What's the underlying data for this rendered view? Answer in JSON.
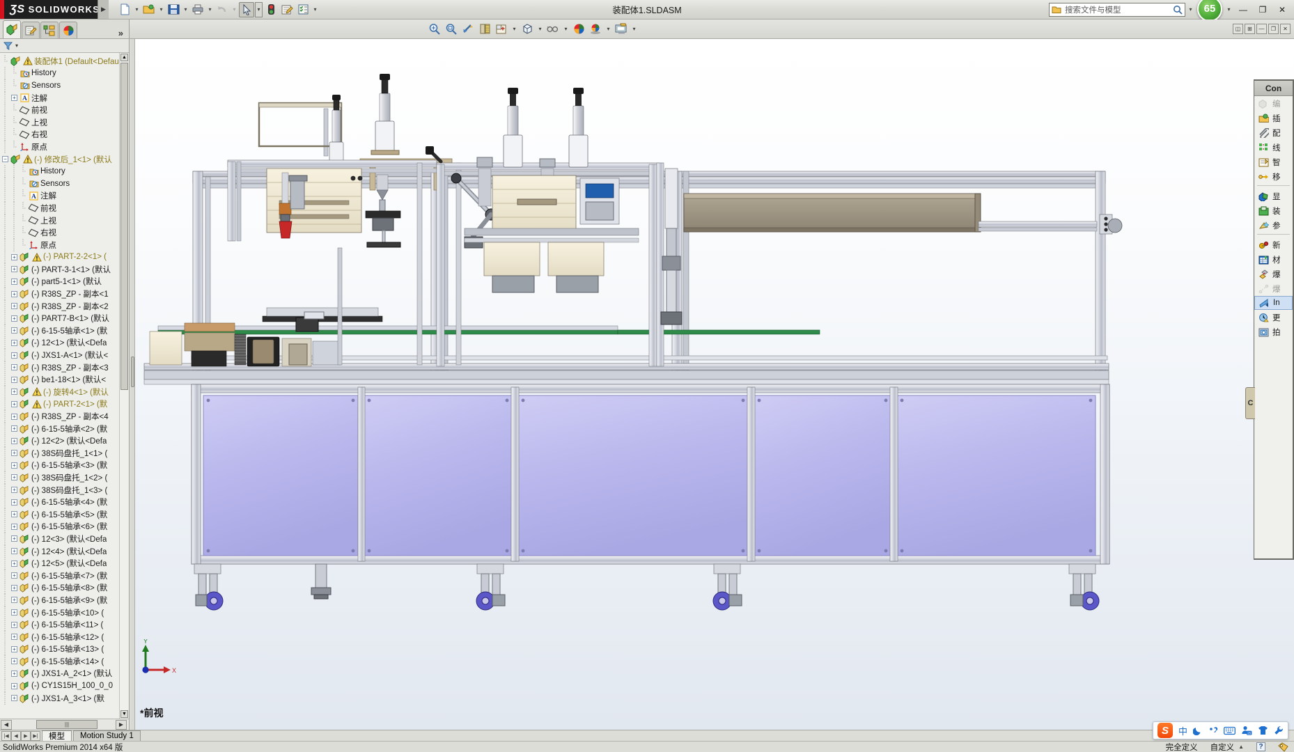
{
  "window": {
    "app_name": "SOLIDWORKS",
    "document_title": "装配体1.SLDASM",
    "help_badge": "65",
    "minimize": "—",
    "restore": "❐",
    "close": "✕"
  },
  "search": {
    "placeholder": "搜索文件与模型",
    "icon": "search-icon"
  },
  "standard_toolbar": [
    {
      "name": "new-document",
      "icon": "page-icon",
      "dropdown": true
    },
    {
      "name": "open-document",
      "icon": "folder-open-icon",
      "dropdown": true
    },
    {
      "name": "save-document",
      "icon": "floppy-icon",
      "dropdown": true
    },
    {
      "name": "print-document",
      "icon": "printer-icon",
      "dropdown": true
    },
    {
      "name": "undo",
      "icon": "undo-arrow-icon",
      "dropdown": true,
      "disabled": true
    },
    {
      "name": "select",
      "icon": "cursor-arrow-icon",
      "dropdown": true,
      "selected": true
    },
    {
      "name": "rebuild",
      "icon": "traffic-light-icon",
      "dropdown": false
    },
    {
      "name": "file-properties",
      "icon": "document-pencil-icon",
      "dropdown": false
    },
    {
      "name": "options",
      "icon": "checklist-gear-icon",
      "dropdown": true
    }
  ],
  "view_toolbar": [
    {
      "name": "zoom-to-fit",
      "icon": "magnifier-fit-icon"
    },
    {
      "name": "zoom-to-area",
      "icon": "magnifier-area-icon"
    },
    {
      "name": "previous-view",
      "icon": "previous-view-icon"
    },
    {
      "name": "section-view",
      "icon": "section-view-icon"
    },
    {
      "name": "view-orientation",
      "icon": "view-orientation-icon",
      "dropdown": true
    },
    {
      "name": "display-style",
      "icon": "cube-icon",
      "dropdown": true
    },
    {
      "name": "hide-show-items",
      "icon": "glasses-icon",
      "dropdown": true
    },
    {
      "name": "apply-scene",
      "icon": "color-sphere-icon"
    },
    {
      "name": "view-settings",
      "icon": "sphere-shadow-icon",
      "dropdown": true
    },
    {
      "name": "display-manager-view",
      "icon": "monitor-icon",
      "dropdown": true
    }
  ],
  "left_panel": {
    "tabs": [
      {
        "name": "feature-manager-tab",
        "icon": "feature-tree-icon",
        "active": true
      },
      {
        "name": "property-manager-tab",
        "icon": "property-pencil-icon",
        "active": false
      },
      {
        "name": "configuration-manager-tab",
        "icon": "configuration-icon",
        "active": false
      },
      {
        "name": "display-manager-tab",
        "icon": "color-wheel-icon",
        "active": false
      }
    ],
    "more_label": "»",
    "filter_label": "",
    "filter_icon": "funnel-icon",
    "scroll_thumb_label": "|||"
  },
  "tree": [
    {
      "label": "装配体1  (Default<Defaul",
      "icon": "assembly-icon",
      "indent": 0,
      "expander": "",
      "warn": true,
      "highlight": true
    },
    {
      "label": "History",
      "icon": "history-icon",
      "indent": 1,
      "expander": ""
    },
    {
      "label": "Sensors",
      "icon": "sensors-icon",
      "indent": 1,
      "expander": ""
    },
    {
      "label": "注解",
      "icon": "annotations-icon",
      "indent": 1,
      "expander": "+"
    },
    {
      "label": "前视",
      "icon": "plane-icon",
      "indent": 1,
      "expander": ""
    },
    {
      "label": "上视",
      "icon": "plane-icon",
      "indent": 1,
      "expander": ""
    },
    {
      "label": "右视",
      "icon": "plane-icon",
      "indent": 1,
      "expander": ""
    },
    {
      "label": "原点",
      "icon": "origin-icon",
      "indent": 1,
      "expander": ""
    },
    {
      "label": "(-) 修改后_1<1> (默认",
      "icon": "assembly-icon",
      "indent": 0,
      "expander": "−",
      "warn": true
    },
    {
      "label": "History",
      "icon": "history-icon",
      "indent": 2,
      "expander": ""
    },
    {
      "label": "Sensors",
      "icon": "sensors-icon",
      "indent": 2,
      "expander": ""
    },
    {
      "label": "注解",
      "icon": "annotations-icon",
      "indent": 2,
      "expander": ""
    },
    {
      "label": "前视",
      "icon": "plane-icon",
      "indent": 2,
      "expander": ""
    },
    {
      "label": "上视",
      "icon": "plane-icon",
      "indent": 2,
      "expander": ""
    },
    {
      "label": "右视",
      "icon": "plane-icon",
      "indent": 2,
      "expander": ""
    },
    {
      "label": "原点",
      "icon": "origin-icon",
      "indent": 2,
      "expander": ""
    },
    {
      "label": "(-) PART-2-2<1>  (",
      "icon": "part-green-icon",
      "indent": 1,
      "expander": "+",
      "warn": true
    },
    {
      "label": "(-) PART-3-1<1>  (默认",
      "icon": "part-green-icon",
      "indent": 1,
      "expander": "+"
    },
    {
      "label": "(-) part5-1<1>  (默认",
      "icon": "part-green-icon",
      "indent": 1,
      "expander": "+"
    },
    {
      "label": "(-) R38S_ZP - 副本<1",
      "icon": "part-yellow-icon",
      "indent": 1,
      "expander": "+"
    },
    {
      "label": "(-) R38S_ZP - 副本<2",
      "icon": "part-yellow-icon",
      "indent": 1,
      "expander": "+"
    },
    {
      "label": "(-) PART7-B<1>  (默认",
      "icon": "part-green-icon",
      "indent": 1,
      "expander": "+"
    },
    {
      "label": "(-) 6-15-5轴承<1>  (默",
      "icon": "part-yellow-icon",
      "indent": 1,
      "expander": "+"
    },
    {
      "label": "(-) 12<1>  (默认<Defa",
      "icon": "part-green-icon",
      "indent": 1,
      "expander": "+"
    },
    {
      "label": "(-) JXS1-A<1>  (默认<",
      "icon": "part-green-icon",
      "indent": 1,
      "expander": "+"
    },
    {
      "label": "(-) R38S_ZP - 副本<3",
      "icon": "part-yellow-icon",
      "indent": 1,
      "expander": "+"
    },
    {
      "label": "(-) be1-18<1>  (默认<",
      "icon": "part-yellow-icon",
      "indent": 1,
      "expander": "+"
    },
    {
      "label": "(-) 旋转4<1>  (默认",
      "icon": "part-green-icon",
      "indent": 1,
      "expander": "+",
      "warn": true
    },
    {
      "label": "(-) PART-2<1>  (默",
      "icon": "part-green-icon",
      "indent": 1,
      "expander": "+",
      "warn": true
    },
    {
      "label": "(-) R38S_ZP - 副本<4",
      "icon": "part-yellow-icon",
      "indent": 1,
      "expander": "+"
    },
    {
      "label": "(-) 6-15-5轴承<2>  (默",
      "icon": "part-yellow-icon",
      "indent": 1,
      "expander": "+"
    },
    {
      "label": "(-) 12<2>  (默认<Defa",
      "icon": "part-green-icon",
      "indent": 1,
      "expander": "+"
    },
    {
      "label": "(-) 38S码盘托_1<1>  (",
      "icon": "part-yellow-icon",
      "indent": 1,
      "expander": "+"
    },
    {
      "label": "(-) 6-15-5轴承<3>  (默",
      "icon": "part-yellow-icon",
      "indent": 1,
      "expander": "+"
    },
    {
      "label": "(-) 38S码盘托_1<2>  (",
      "icon": "part-yellow-icon",
      "indent": 1,
      "expander": "+"
    },
    {
      "label": "(-) 38S码盘托_1<3>  (",
      "icon": "part-yellow-icon",
      "indent": 1,
      "expander": "+"
    },
    {
      "label": "(-) 6-15-5轴承<4>  (默",
      "icon": "part-yellow-icon",
      "indent": 1,
      "expander": "+"
    },
    {
      "label": "(-) 6-15-5轴承<5>  (默",
      "icon": "part-yellow-icon",
      "indent": 1,
      "expander": "+"
    },
    {
      "label": "(-) 6-15-5轴承<6>  (默",
      "icon": "part-yellow-icon",
      "indent": 1,
      "expander": "+"
    },
    {
      "label": "(-) 12<3>  (默认<Defa",
      "icon": "part-green-icon",
      "indent": 1,
      "expander": "+"
    },
    {
      "label": "(-) 12<4>  (默认<Defa",
      "icon": "part-green-icon",
      "indent": 1,
      "expander": "+"
    },
    {
      "label": "(-) 12<5>  (默认<Defa",
      "icon": "part-green-icon",
      "indent": 1,
      "expander": "+"
    },
    {
      "label": "(-) 6-15-5轴承<7>  (默",
      "icon": "part-yellow-icon",
      "indent": 1,
      "expander": "+"
    },
    {
      "label": "(-) 6-15-5轴承<8>  (默",
      "icon": "part-yellow-icon",
      "indent": 1,
      "expander": "+"
    },
    {
      "label": "(-) 6-15-5轴承<9>  (默",
      "icon": "part-yellow-icon",
      "indent": 1,
      "expander": "+"
    },
    {
      "label": "(-) 6-15-5轴承<10>  (",
      "icon": "part-yellow-icon",
      "indent": 1,
      "expander": "+"
    },
    {
      "label": "(-) 6-15-5轴承<11>  (",
      "icon": "part-yellow-icon",
      "indent": 1,
      "expander": "+"
    },
    {
      "label": "(-) 6-15-5轴承<12>  (",
      "icon": "part-yellow-icon",
      "indent": 1,
      "expander": "+"
    },
    {
      "label": "(-) 6-15-5轴承<13>  (",
      "icon": "part-yellow-icon",
      "indent": 1,
      "expander": "+"
    },
    {
      "label": "(-) 6-15-5轴承<14>  (",
      "icon": "part-yellow-icon",
      "indent": 1,
      "expander": "+"
    },
    {
      "label": "(-) JXS1-A_2<1>  (默认",
      "icon": "part-green-icon",
      "indent": 1,
      "expander": "+"
    },
    {
      "label": "(-) CY1S15H_100_0_0",
      "icon": "part-green-icon",
      "indent": 1,
      "expander": "+"
    },
    {
      "label": "(-) JXS1-A_3<1>  (默",
      "icon": "part-green-icon",
      "indent": 1,
      "expander": "+"
    }
  ],
  "command_panel": {
    "title": "Con",
    "items": [
      {
        "label": "编",
        "icon": "edit-component-icon",
        "disabled": true
      },
      {
        "label": "插",
        "icon": "insert-component-icon",
        "disabled": false
      },
      {
        "label": "配",
        "icon": "mate-paperclip-icon",
        "disabled": false
      },
      {
        "label": "线",
        "icon": "linear-pattern-icon",
        "disabled": false
      },
      {
        "label": "智",
        "icon": "smart-fastener-icon",
        "disabled": false
      },
      {
        "label": "移",
        "icon": "move-component-icon",
        "disabled": false
      },
      {
        "label": "显",
        "icon": "show-hidden-icon",
        "disabled": false,
        "sep_before": true
      },
      {
        "label": "装",
        "icon": "assembly-features-icon",
        "disabled": false
      },
      {
        "label": "参",
        "icon": "reference-geometry-icon",
        "disabled": false
      },
      {
        "label": "新",
        "icon": "new-motion-study-icon",
        "disabled": false,
        "sep_before": true
      },
      {
        "label": "材",
        "icon": "bill-of-materials-icon",
        "disabled": false
      },
      {
        "label": "爆",
        "icon": "exploded-view-icon",
        "disabled": false
      },
      {
        "label": "爆",
        "icon": "explode-line-sketch-icon",
        "disabled": true
      },
      {
        "label": "In",
        "icon": "instant3d-icon",
        "disabled": false,
        "selected": true
      },
      {
        "label": "更",
        "icon": "update-speedpak-icon",
        "disabled": false
      },
      {
        "label": "拍",
        "icon": "take-snapshot-icon",
        "disabled": false
      }
    ],
    "side_tab": "C"
  },
  "graphics": {
    "view_label": "*前视",
    "triad": {
      "y_axis": "Y",
      "x_axis": "X"
    },
    "model_description": "自动化装配生产线设备 3D 装配体 - 前视图"
  },
  "bottom_tabs": {
    "nav": [
      "|◀",
      "◀",
      "▶",
      "▶|"
    ],
    "tabs": [
      {
        "label": "模型",
        "active": true
      },
      {
        "label": "Motion Study 1",
        "active": false
      }
    ]
  },
  "status_bar": {
    "left": "SolidWorks Premium 2014 x64 版",
    "state": "完全定义",
    "units": "自定义",
    "units_caret": "▲",
    "help": "?",
    "tag_icon": "tag-icon"
  },
  "ime": {
    "logo": "S",
    "mode": "中",
    "items": [
      "moon-icon",
      "punctuation-icon",
      "keyboard-icon",
      "user-25-icon",
      "skin-icon",
      "wrench-icon"
    ],
    "badge": "25"
  },
  "colors": {
    "accent_red": "#d4121c",
    "titlebar": "#dcdcd7",
    "panel": "#eeeeea",
    "tree_warn": "#8a7a1a",
    "selection": "#cfe0f4",
    "machine_panel": "#b9b8ea",
    "machine_frame": "#c9cbd2",
    "conveyor_green": "#2f8f4a"
  }
}
